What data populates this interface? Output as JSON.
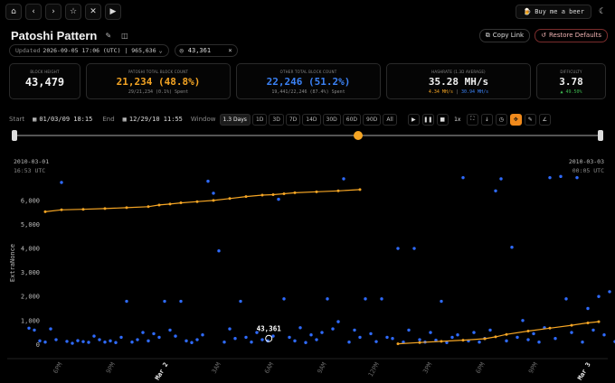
{
  "nav": {
    "beer_label": "Buy me a beer",
    "icons": [
      "home-icon",
      "chevron-left-icon",
      "chevron-right-icon",
      "star-icon",
      "x-logo-icon",
      "youtube-icon"
    ]
  },
  "header": {
    "title": "Patoshi Pattern",
    "copy_label": "Copy Link",
    "restore_label": "Restore Defaults"
  },
  "filter": {
    "updated_label": "Updated",
    "updated_value": "2026-09-05 17:06 (UTC) | 965,636",
    "search_value": "43,361"
  },
  "stats": [
    {
      "label": "BLOCK HEIGHT",
      "value": "43,479",
      "sub": "",
      "color": "#f2f2f2"
    },
    {
      "label": "PATOSHI TOTAL BLOCK COUNT",
      "value": "21,234 (48.8%)",
      "sub": "29/21,234 (0.1%) Spent",
      "color": "#f5a524"
    },
    {
      "label": "OTHER TOTAL BLOCK COUNT",
      "value": "22,246 (51.2%)",
      "sub": "19,441/22,246 (87.4%) Spent",
      "color": "#3b82f6"
    },
    {
      "label": "HASHRATE (1.3D AVERAGE)",
      "value": "35.28 MH/s",
      "sub_orange": "4.34 MH/s",
      "sub_sep": " | ",
      "sub_blue": "30.94 MH/s",
      "color": "#f2f2f2"
    },
    {
      "label": "DIFFICULTY",
      "value": "3.78",
      "sub": "▲ 49.50%",
      "color": "#f2f2f2"
    }
  ],
  "controls": {
    "start_label": "Start",
    "start_value": "01/03/09 18:15",
    "end_label": "End",
    "end_value": "12/29/10 11:55",
    "window_label": "Window",
    "windows": [
      "1.3 Days",
      "1D",
      "3D",
      "7D",
      "14D",
      "30D",
      "60D",
      "90D",
      "All"
    ],
    "active_window": "1.3 Days",
    "speed": "1x"
  },
  "slider": {
    "position": 0.58
  },
  "chart_data": {
    "type": "scatter",
    "start_title": "2010-03-01",
    "start_time": "16:53 UTC",
    "end_title": "2010-03-03",
    "end_time": "00:05 UTC",
    "ylabel": "ExtraNonce",
    "ylim": [
      -400,
      7200
    ],
    "y_ticks": [
      "0",
      "1,000",
      "2,000",
      "3,000",
      "4,000",
      "5,000",
      "6,000"
    ],
    "x_ticks": [
      "6PM",
      "9PM",
      "Mar 2",
      "3AM",
      "6AM",
      "9AM",
      "12PM",
      "3PM",
      "6PM",
      "9PM",
      "Mar 3"
    ],
    "bold_x_ticks": [
      "Mar 2",
      "Mar 3"
    ],
    "highlight": {
      "label": "43,361",
      "x": 0.462,
      "y": 250
    },
    "series": [
      {
        "name": "Patoshi",
        "color": "#f5a524",
        "segments": [
          [
            [
              0.05,
              5530
            ],
            [
              0.08,
              5610
            ],
            [
              0.12,
              5630
            ],
            [
              0.16,
              5660
            ],
            [
              0.2,
              5700
            ],
            [
              0.24,
              5740
            ],
            [
              0.26,
              5810
            ],
            [
              0.28,
              5850
            ],
            [
              0.3,
              5900
            ],
            [
              0.33,
              5950
            ],
            [
              0.36,
              6000
            ],
            [
              0.39,
              6080
            ],
            [
              0.42,
              6160
            ],
            [
              0.45,
              6220
            ],
            [
              0.47,
              6240
            ],
            [
              0.49,
              6280
            ],
            [
              0.51,
              6320
            ],
            [
              0.55,
              6360
            ],
            [
              0.59,
              6400
            ],
            [
              0.63,
              6450
            ]
          ],
          [
            [
              0.7,
              30
            ],
            [
              0.74,
              80
            ],
            [
              0.78,
              130
            ],
            [
              0.82,
              180
            ],
            [
              0.86,
              240
            ],
            [
              0.88,
              320
            ],
            [
              0.9,
              420
            ],
            [
              0.94,
              560
            ],
            [
              0.98,
              680
            ],
            [
              1.02,
              800
            ],
            [
              1.05,
              900
            ],
            [
              1.07,
              950
            ]
          ]
        ]
      },
      {
        "name": "Other",
        "color": "#2f6bff",
        "points": [
          [
            0.02,
            680
          ],
          [
            0.03,
            600
          ],
          [
            0.04,
            150
          ],
          [
            0.05,
            100
          ],
          [
            0.06,
            650
          ],
          [
            0.07,
            200
          ],
          [
            0.08,
            6750
          ],
          [
            0.09,
            130
          ],
          [
            0.1,
            50
          ],
          [
            0.11,
            160
          ],
          [
            0.12,
            120
          ],
          [
            0.13,
            90
          ],
          [
            0.14,
            350
          ],
          [
            0.15,
            200
          ],
          [
            0.16,
            100
          ],
          [
            0.17,
            150
          ],
          [
            0.18,
            80
          ],
          [
            0.19,
            300
          ],
          [
            0.2,
            1800
          ],
          [
            0.21,
            100
          ],
          [
            0.22,
            200
          ],
          [
            0.23,
            500
          ],
          [
            0.24,
            150
          ],
          [
            0.25,
            450
          ],
          [
            0.26,
            300
          ],
          [
            0.27,
            1800
          ],
          [
            0.28,
            600
          ],
          [
            0.29,
            350
          ],
          [
            0.3,
            1800
          ],
          [
            0.31,
            150
          ],
          [
            0.32,
            80
          ],
          [
            0.33,
            200
          ],
          [
            0.34,
            400
          ],
          [
            0.35,
            6800
          ],
          [
            0.36,
            6300
          ],
          [
            0.37,
            3900
          ],
          [
            0.38,
            100
          ],
          [
            0.39,
            650
          ],
          [
            0.4,
            250
          ],
          [
            0.41,
            1800
          ],
          [
            0.42,
            300
          ],
          [
            0.43,
            100
          ],
          [
            0.44,
            500
          ],
          [
            0.45,
            200
          ],
          [
            0.46,
            150
          ],
          [
            0.47,
            350
          ],
          [
            0.48,
            6050
          ],
          [
            0.49,
            1900
          ],
          [
            0.5,
            300
          ],
          [
            0.51,
            150
          ],
          [
            0.52,
            700
          ],
          [
            0.53,
            80
          ],
          [
            0.54,
            400
          ],
          [
            0.55,
            200
          ],
          [
            0.56,
            500
          ],
          [
            0.57,
            1900
          ],
          [
            0.58,
            650
          ],
          [
            0.59,
            950
          ],
          [
            0.6,
            6900
          ],
          [
            0.61,
            100
          ],
          [
            0.62,
            600
          ],
          [
            0.63,
            300
          ],
          [
            0.64,
            1900
          ],
          [
            0.65,
            450
          ],
          [
            0.66,
            120
          ],
          [
            0.67,
            1900
          ],
          [
            0.68,
            300
          ],
          [
            0.69,
            250
          ],
          [
            0.7,
            4000
          ],
          [
            0.71,
            100
          ],
          [
            0.72,
            600
          ],
          [
            0.73,
            4000
          ],
          [
            0.74,
            200
          ],
          [
            0.75,
            100
          ],
          [
            0.76,
            500
          ],
          [
            0.77,
            180
          ],
          [
            0.78,
            1800
          ],
          [
            0.79,
            80
          ],
          [
            0.8,
            300
          ],
          [
            0.81,
            400
          ],
          [
            0.82,
            6950
          ],
          [
            0.83,
            150
          ],
          [
            0.84,
            500
          ],
          [
            0.85,
            100
          ],
          [
            0.86,
            250
          ],
          [
            0.87,
            600
          ],
          [
            0.88,
            6400
          ],
          [
            0.89,
            6900
          ],
          [
            0.9,
            150
          ],
          [
            0.91,
            4050
          ],
          [
            0.92,
            300
          ],
          [
            0.93,
            1000
          ],
          [
            0.94,
            200
          ],
          [
            0.95,
            450
          ],
          [
            0.96,
            100
          ],
          [
            0.97,
            700
          ],
          [
            0.98,
            6950
          ],
          [
            0.99,
            250
          ],
          [
            1.0,
            7000
          ],
          [
            1.01,
            1900
          ],
          [
            1.02,
            500
          ],
          [
            1.03,
            6950
          ],
          [
            1.04,
            100
          ],
          [
            1.05,
            1500
          ],
          [
            1.06,
            600
          ],
          [
            1.07,
            2000
          ],
          [
            1.08,
            400
          ],
          [
            1.09,
            2200
          ],
          [
            1.1,
            120
          ]
        ]
      }
    ]
  }
}
